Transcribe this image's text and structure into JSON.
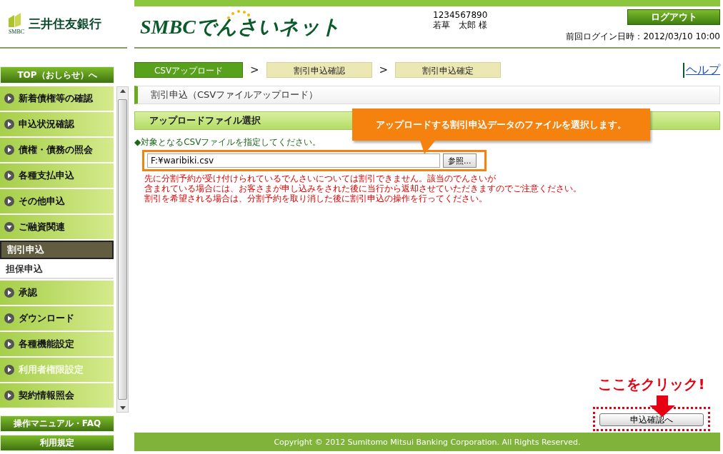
{
  "header": {
    "bank_name": "三井住友銀行",
    "bank_mark": "SMBC",
    "service_name": "SMBCでんさいネット",
    "account_number": "1234567890",
    "user_name": "若草　太郎 様",
    "logout_button": "ログアウト",
    "last_login": "前回ログイン日時：2012/03/10 10:00"
  },
  "sidebar": {
    "top_button": "TOP（おしらせ）へ",
    "items": [
      {
        "kind": "menu",
        "label": "新着債権等の確認",
        "expanded": false,
        "disabled": false
      },
      {
        "kind": "menu",
        "label": "申込状況確認",
        "expanded": false,
        "disabled": false
      },
      {
        "kind": "menu",
        "label": "債権・債務の照会",
        "expanded": false,
        "disabled": false
      },
      {
        "kind": "menu",
        "label": "各種支払申込",
        "expanded": false,
        "disabled": false
      },
      {
        "kind": "menu",
        "label": "その他申込",
        "expanded": false,
        "disabled": false
      },
      {
        "kind": "menu",
        "label": "ご融資関連",
        "expanded": true,
        "disabled": false
      },
      {
        "kind": "sub",
        "label": "割引申込",
        "selected": true
      },
      {
        "kind": "sub",
        "label": "担保申込",
        "selected": false
      },
      {
        "kind": "menu",
        "label": "承認",
        "expanded": false,
        "disabled": false
      },
      {
        "kind": "menu",
        "label": "ダウンロード",
        "expanded": false,
        "disabled": false
      },
      {
        "kind": "menu",
        "label": "各種機能設定",
        "expanded": false,
        "disabled": false
      },
      {
        "kind": "menu",
        "label": "利用者権限設定",
        "expanded": false,
        "disabled": true
      },
      {
        "kind": "menu",
        "label": "契約情報照会",
        "expanded": false,
        "disabled": false
      }
    ],
    "bottom_buttons": [
      "操作マニュアル・FAQ",
      "利用規定"
    ]
  },
  "steps": [
    {
      "label": "CSVアップロード",
      "selected": true
    },
    {
      "prefix": ">",
      "label": "割引申込確認",
      "selected": false
    },
    {
      "prefix": ">",
      "label": "割引申込確定",
      "selected": false
    }
  ],
  "help_link": "ヘルプ",
  "page_title": "割引申込（CSVファイルアップロード）",
  "section_title": "アップロードファイル選択",
  "instruction": "◆対象となるCSVファイルを指定してください。",
  "file_field": {
    "value": "F:¥waribiki.csv",
    "browse_button": "参照..."
  },
  "warning_lines": [
    "先に分割予約が受け付けられているでんさいについては割引できません。該当のでんさいが",
    "含まれている場合には、お客さまが申し込みをされた後に当行から返却させていただきますのでご注意ください。",
    "割引を希望される場合は、分割予約を取り消した後に割引申込の操作を行ってください。"
  ],
  "callout": "アップロードする割引申込データのファイルを選択します。",
  "click_hint": "ここをクリック!",
  "submit_button": "申込確認へ",
  "footer": "Copyright © 2012 Sumitomo Mitsui Banking Corporation. All Rights Reserved."
}
